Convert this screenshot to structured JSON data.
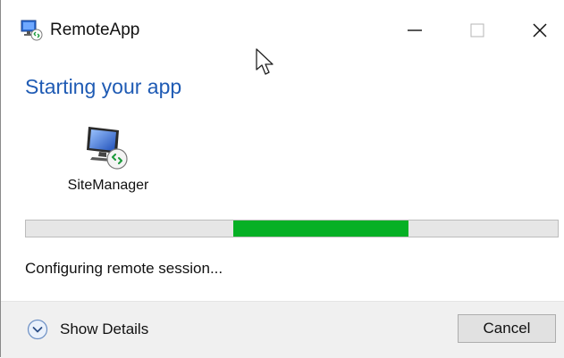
{
  "window": {
    "title": "RemoteApp",
    "icon": "remoteapp-icon",
    "controls": [
      "minimize-icon",
      "maximize-icon",
      "close-icon"
    ]
  },
  "main": {
    "heading": "Starting your app",
    "app": {
      "name": "SiteManager",
      "icon": "remote-desktop-monitor-icon"
    },
    "progress": {
      "start_fraction": 0.39,
      "end_fraction": 0.72
    },
    "status": "Configuring remote session..."
  },
  "footer": {
    "show_details_label": "Show Details",
    "cancel_label": "Cancel"
  },
  "colors": {
    "heading": "#1f5bb4",
    "progress_fill": "#06b025",
    "progress_track": "#e6e6e6",
    "footer_bg": "#f0f0f0"
  }
}
